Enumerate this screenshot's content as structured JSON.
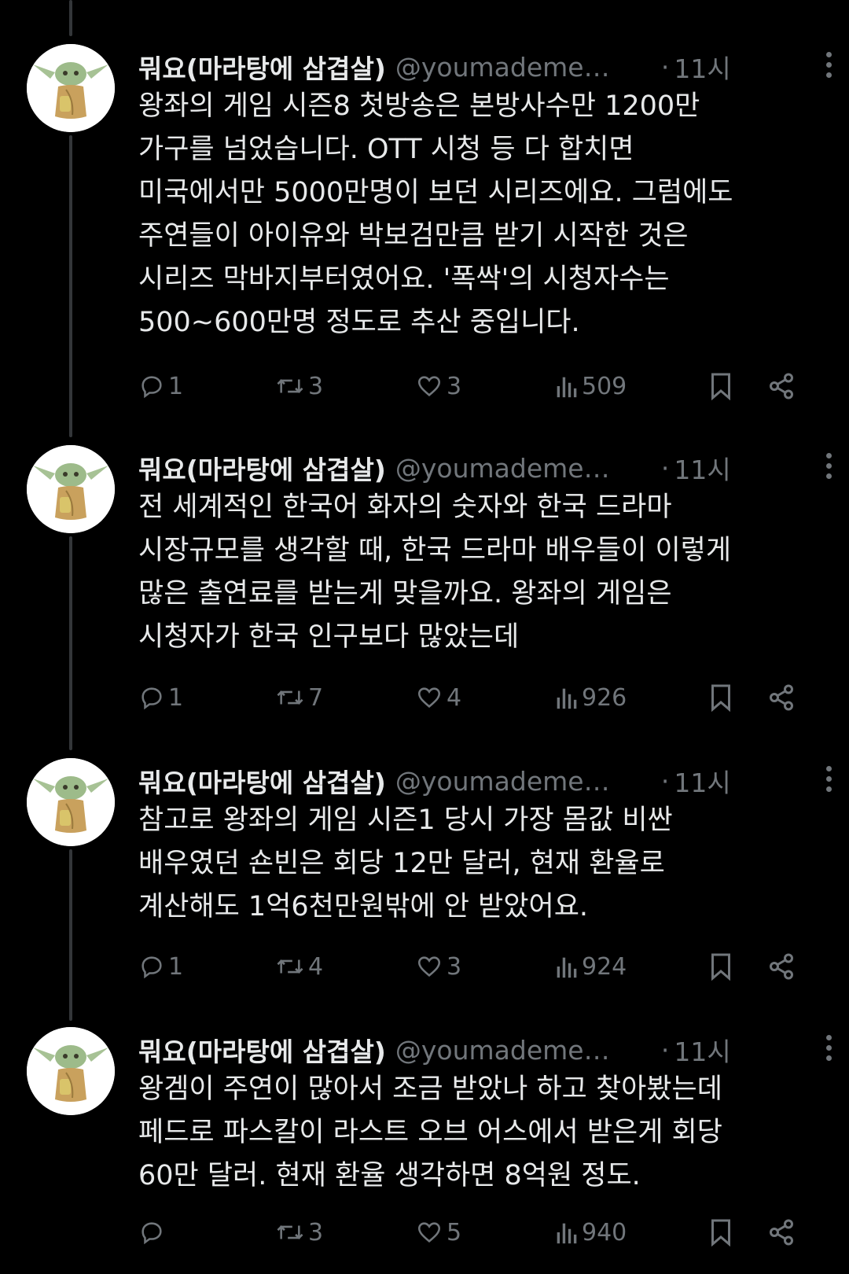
{
  "colors": {
    "background": "#000000",
    "text_primary": "#e7e9ea",
    "text_secondary": "#71767b",
    "thread_line": "#333639"
  },
  "tweets": [
    {
      "display_name": "뭐요(마라탕에 삼겹살)",
      "handle": "@youmademe…",
      "time_dot": "·",
      "time": "11시",
      "text": "왕좌의 게임 시즌8 첫방송은 본방사수만 1200만\n가구를 넘었습니다. OTT 시청 등 다 합치면\n미국에서만 5000만명이 보던 시리즈에요. 그럼에도\n주연들이 아이유와 박보검만큼 받기 시작한 것은\n시리즈 막바지부터였어요. '폭싹'의 시청자수는\n500~600만명 정도로 추산 중입니다.",
      "replies": "1",
      "retweets": "3",
      "likes": "3",
      "views": "509",
      "icons": [
        "reply-icon",
        "retweet-icon",
        "like-icon",
        "views-icon",
        "bookmark-icon",
        "share-icon"
      ]
    },
    {
      "display_name": "뭐요(마라탕에 삼겹살)",
      "handle": "@youmademe…",
      "time_dot": "·",
      "time": "11시",
      "text": "전 세계적인 한국어 화자의 숫자와 한국 드라마\n시장규모를 생각할 때, 한국 드라마 배우들이 이렇게\n많은 출연료를 받는게 맞을까요. 왕좌의 게임은\n시청자가 한국 인구보다 많았는데",
      "replies": "1",
      "retweets": "7",
      "likes": "4",
      "views": "926",
      "icons": [
        "reply-icon",
        "retweet-icon",
        "like-icon",
        "views-icon",
        "bookmark-icon",
        "share-icon"
      ]
    },
    {
      "display_name": "뭐요(마라탕에 삼겹살)",
      "handle": "@youmademe…",
      "time_dot": "·",
      "time": "11시",
      "text": "참고로 왕좌의 게임 시즌1 당시 가장 몸값 비싼\n배우였던 숀빈은 회당 12만 달러, 현재 환율로\n계산해도 1억6천만원밖에 안 받았어요.",
      "replies": "1",
      "retweets": "4",
      "likes": "3",
      "views": "924",
      "icons": [
        "reply-icon",
        "retweet-icon",
        "like-icon",
        "views-icon",
        "bookmark-icon",
        "share-icon"
      ]
    },
    {
      "display_name": "뭐요(마라탕에 삼겹살)",
      "handle": "@youmademe…",
      "time_dot": "·",
      "time": "11시",
      "text": "왕겜이 주연이 많아서 조금 받았나 하고 찾아봤는데\n페드로 파스칼이 라스트 오브 어스에서 받은게 회당\n60만 달러. 현재 환율 생각하면 8억원 정도.",
      "replies": "",
      "retweets": "3",
      "likes": "5",
      "views": "940",
      "icons": [
        "reply-icon",
        "retweet-icon",
        "like-icon",
        "views-icon",
        "bookmark-icon",
        "share-icon"
      ]
    }
  ]
}
